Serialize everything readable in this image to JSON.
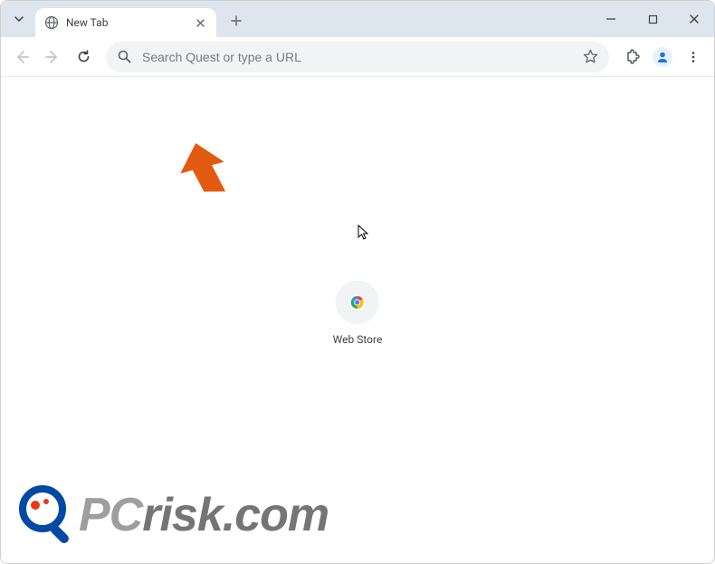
{
  "tab": {
    "title": "New Tab"
  },
  "omnibox": {
    "placeholder": "Search Quest or type a URL"
  },
  "shortcut": {
    "label": "Web Store"
  },
  "watermark": {
    "text_light": "PC",
    "text_dark": "risk.com"
  }
}
